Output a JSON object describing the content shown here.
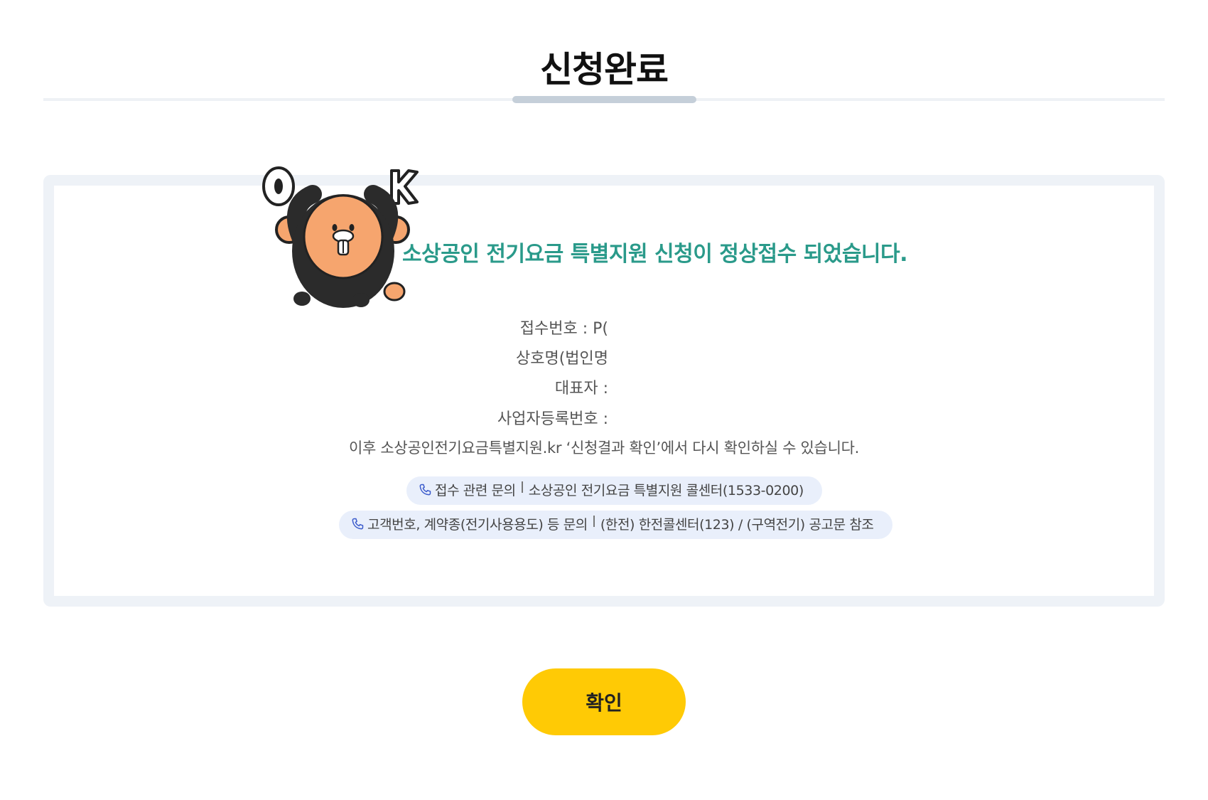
{
  "header": {
    "title": "신청완료"
  },
  "mascot": {
    "letters": [
      "O",
      "K"
    ]
  },
  "result": {
    "headline": "소상공인 전기요금 특별지원 신청이 정상접수 되었습니다.",
    "fields": [
      {
        "label": "접수번호 : P("
      },
      {
        "label": "상호명(법인명"
      },
      {
        "label": "대표자 :"
      },
      {
        "label": "사업자등록번호 :"
      }
    ],
    "note": "이후 소상공인전기요금특별지원.kr ‘신청결과 확인’에서 다시 확인하실 수 있습니다.",
    "contacts": [
      {
        "topic": "접수 관련 문의",
        "detail": "소상공인 전기요금 특별지원 콜센터(1533-0200)",
        "icon": "phone-icon"
      },
      {
        "topic": "고객번호, 계약종(전기사용용도) 등 문의",
        "detail": "(한전) 한전콜센터(123) / (구역전기) 공고문 참조",
        "icon": "phone-icon"
      }
    ]
  },
  "actions": {
    "confirm_label": "확인"
  },
  "colors": {
    "accent_yellow": "#ffca05",
    "headline_teal": "#2a9a8a",
    "card_border": "#eef2f7",
    "contact_bg": "#e9effb"
  }
}
